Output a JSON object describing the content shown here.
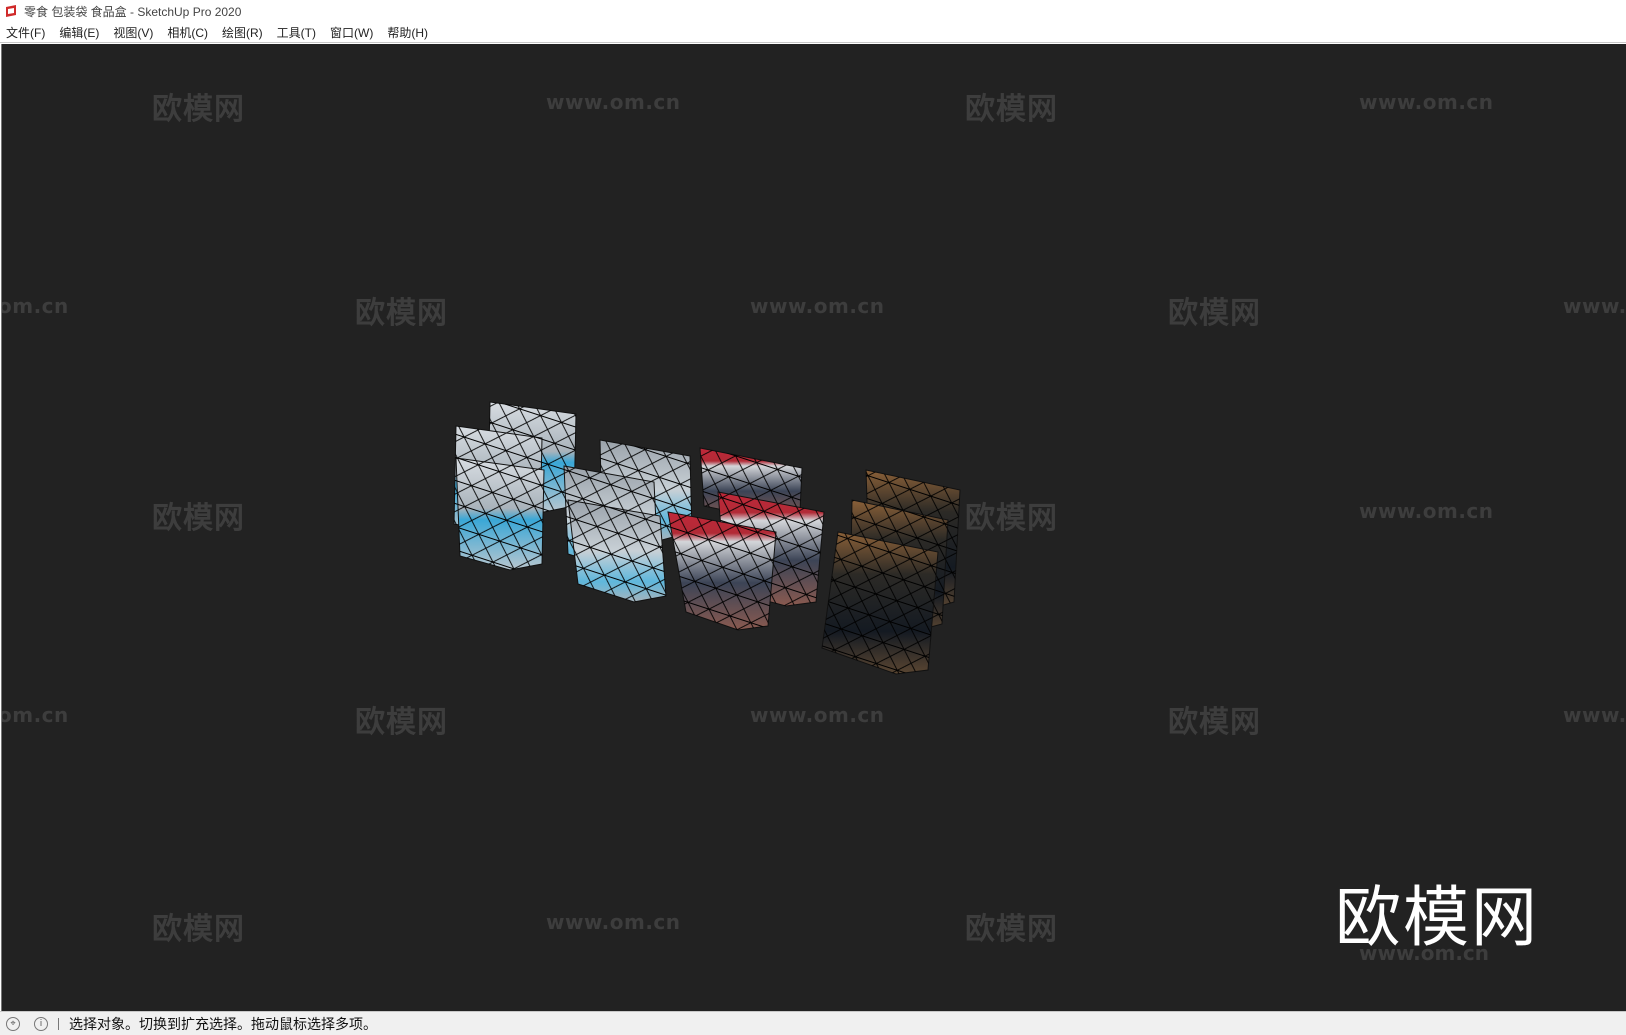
{
  "window": {
    "title": "零食 包装袋 食品盒 - SketchUp Pro 2020",
    "app_icon": "sketchup-icon"
  },
  "menubar": {
    "items": [
      {
        "label": "文件(F)"
      },
      {
        "label": "编辑(E)"
      },
      {
        "label": "视图(V)"
      },
      {
        "label": "相机(C)"
      },
      {
        "label": "绘图(R)"
      },
      {
        "label": "工具(T)"
      },
      {
        "label": "窗口(W)"
      },
      {
        "label": "帮助(H)"
      }
    ]
  },
  "watermark": {
    "brand": "欧模网",
    "url": "www.om.cn",
    "url_partial_left": "om.cn",
    "url_partial_right": "www.",
    "big_brand": "欧模网"
  },
  "scene": {
    "objects": [
      "snack-bag-blue",
      "snack-bag-blue-light",
      "snack-bag-red",
      "snack-bag-dark"
    ]
  },
  "statusbar": {
    "geo_icon": "location-icon",
    "info_icon": "info-icon",
    "message": "选择对象。切换到扩充选择。拖动鼠标选择多项。"
  },
  "colors": {
    "viewport_bg": "#222222",
    "watermark": "#3d3d3d",
    "bag_blue": "#38a8d8",
    "bag_red": "#c0283a",
    "bag_brown": "#8a6038"
  }
}
